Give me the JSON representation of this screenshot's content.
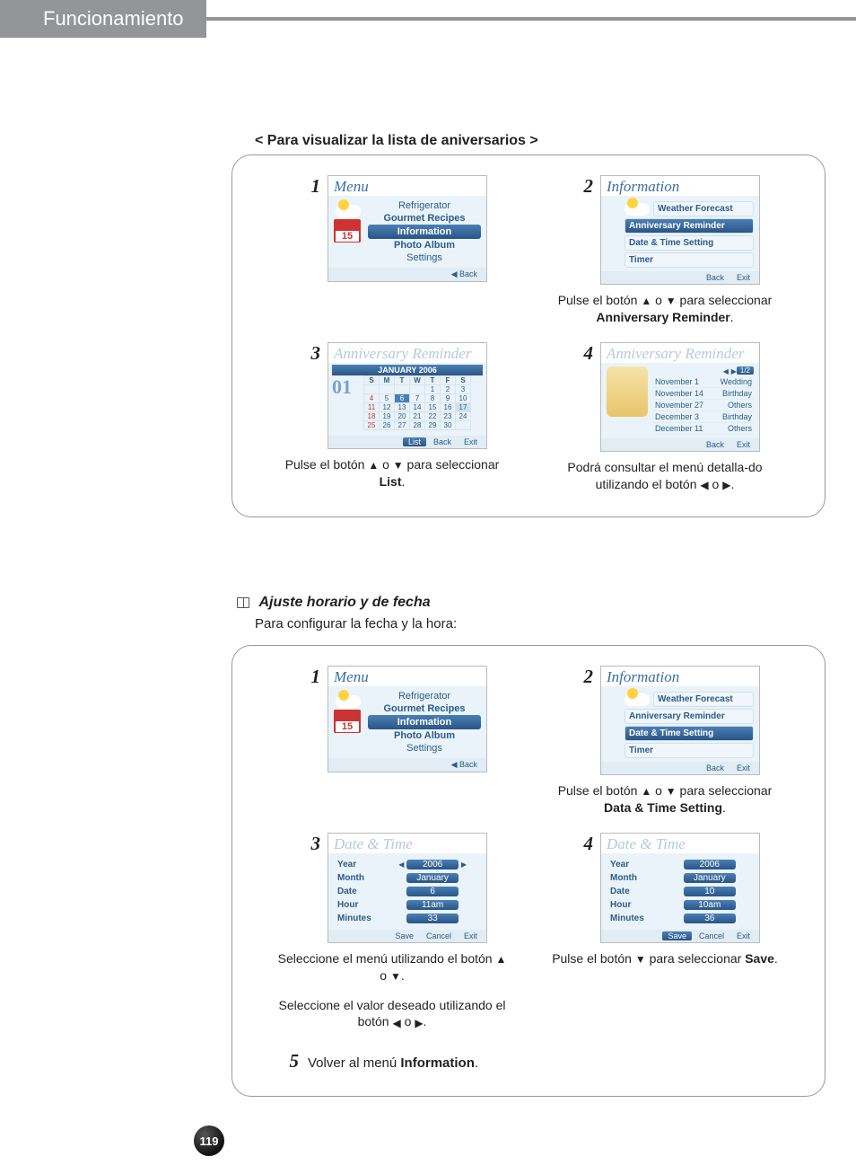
{
  "header": {
    "tab": "Funcionamiento"
  },
  "page_number": "119",
  "section1": {
    "title": "< Para visualizar la lista de aniversarios >",
    "step1": {
      "num": "1",
      "screen_title": "Menu",
      "items": [
        "Refrigerator",
        "Gourmet Recipes",
        "Information",
        "Photo Album",
        "Settings"
      ],
      "back": "◀ Back"
    },
    "step2": {
      "num": "2",
      "screen_title": "Information",
      "items": [
        "Weather Forecast",
        "Anniversary Reminder",
        "Date & Time Setting",
        "Timer"
      ],
      "footer": [
        "Back",
        "Exit"
      ],
      "caption_a": "Pulse el botón ",
      "caption_b": " o ",
      "caption_c": " para seleccionar ",
      "caption_bold": "Anniversary Reminder",
      "caption_d": "."
    },
    "step3": {
      "num": "3",
      "screen_title": "Anniversary Reminder",
      "month": "JANUARY 2006",
      "dow": [
        "S",
        "M",
        "T",
        "W",
        "T",
        "F",
        "S"
      ],
      "weeks": [
        [
          "",
          "",
          "",
          "",
          "1",
          "2",
          "3"
        ],
        [
          "4",
          "5",
          "6",
          "7",
          "8",
          "9",
          "10"
        ],
        [
          "11",
          "12",
          "13",
          "14",
          "15",
          "16",
          "17"
        ],
        [
          "18",
          "19",
          "20",
          "21",
          "22",
          "23",
          "24"
        ],
        [
          "25",
          "26",
          "27",
          "28",
          "29",
          "30",
          ""
        ]
      ],
      "big": "01",
      "footer": [
        "List",
        "Back",
        "Exit"
      ],
      "caption_a": "Pulse el botón ",
      "caption_b": " o ",
      "caption_c": " para seleccionar ",
      "caption_bold": "List",
      "caption_d": "."
    },
    "step4": {
      "num": "4",
      "screen_title": "Anniversary Reminder",
      "page": "1/2",
      "rows": [
        [
          "November 1",
          "Wedding"
        ],
        [
          "November 14",
          "Birthday"
        ],
        [
          "November 27",
          "Others"
        ],
        [
          "December 3",
          "Birthday"
        ],
        [
          "December 11",
          "Others"
        ]
      ],
      "footer": [
        "Back",
        "Exit"
      ],
      "caption_a": "Podrá consultar el menú detalla-do utilizando el botón ",
      "caption_b": " o ",
      "caption_c": "."
    }
  },
  "section2": {
    "title": "Ajuste horario y de fecha",
    "intro": "Para configurar la fecha y la hora:",
    "step1": {
      "num": "1",
      "screen_title": "Menu",
      "items": [
        "Refrigerator",
        "Gourmet Recipes",
        "Information",
        "Photo Album",
        "Settings"
      ],
      "back": "◀ Back"
    },
    "step2": {
      "num": "2",
      "screen_title": "Information",
      "items": [
        "Weather Forecast",
        "Anniversary Reminder",
        "Date & Time Setting",
        "Timer"
      ],
      "footer": [
        "Back",
        "Exit"
      ],
      "caption_a": "Pulse el botón ",
      "caption_b": " o ",
      "caption_c": " para seleccionar ",
      "caption_bold": "Data & Time Setting",
      "caption_d": "."
    },
    "step3": {
      "num": "3",
      "screen_title": "Date & Time",
      "rows": [
        [
          "Year",
          "2006"
        ],
        [
          "Month",
          "January"
        ],
        [
          "Date",
          "6"
        ],
        [
          "Hour",
          "11am"
        ],
        [
          "Minutes",
          "33"
        ]
      ],
      "footer": [
        "Save",
        "Cancel",
        "Exit"
      ],
      "caption1_a": "Seleccione el menú utilizando el botón ",
      "caption1_b": " o ",
      "caption1_c": ".",
      "caption2_a": "Seleccione el valor deseado utilizando el botón ",
      "caption2_b": " o ",
      "caption2_c": "."
    },
    "step4": {
      "num": "4",
      "screen_title": "Date & Time",
      "rows": [
        [
          "Year",
          "2006"
        ],
        [
          "Month",
          "January"
        ],
        [
          "Date",
          "10"
        ],
        [
          "Hour",
          "10am"
        ],
        [
          "Minutes",
          "36"
        ]
      ],
      "footer": [
        "Save",
        "Cancel",
        "Exit"
      ],
      "caption_a": "Pulse el botón ",
      "caption_b": " para seleccionar ",
      "caption_bold": "Save",
      "caption_c": "."
    },
    "step5": {
      "num": "5",
      "caption_a": "Volver al menú ",
      "caption_bold": "Information",
      "caption_b": "."
    }
  }
}
